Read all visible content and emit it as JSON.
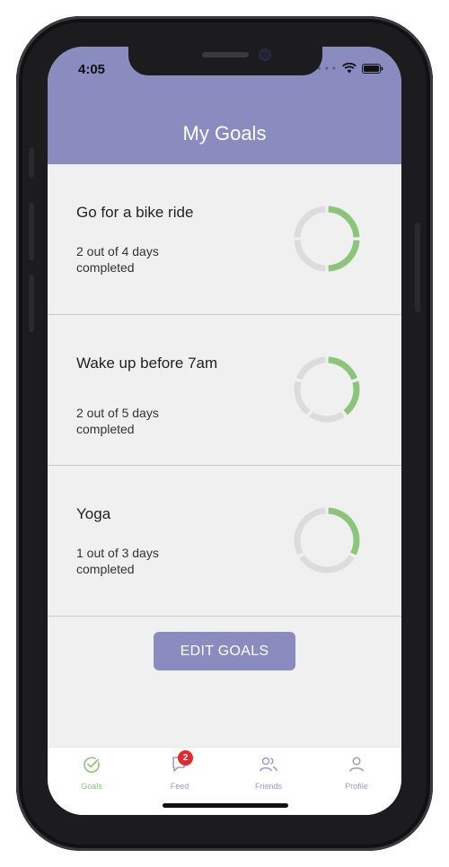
{
  "status_bar": {
    "time": "4:05"
  },
  "header": {
    "title": "My Goals"
  },
  "goals": [
    {
      "title": "Go for a bike ride",
      "progress_text": "2 out of 4 days completed",
      "completed": 2,
      "total": 4
    },
    {
      "title": "Wake up before 7am",
      "progress_text": "2 out of 5 days completed",
      "completed": 2,
      "total": 5
    },
    {
      "title": "Yoga",
      "progress_text": "1 out of 3 days completed",
      "completed": 1,
      "total": 3
    }
  ],
  "edit_button": {
    "label": "EDIT GOALS"
  },
  "tabbar": {
    "items": [
      {
        "label": "Goals",
        "icon": "check-circle-icon",
        "active": true
      },
      {
        "label": "Feed",
        "icon": "chat-bubble-icon",
        "active": false,
        "badge": "2"
      },
      {
        "label": "Friends",
        "icon": "people-icon",
        "active": false
      },
      {
        "label": "Profile",
        "icon": "person-icon",
        "active": false
      }
    ]
  },
  "colors": {
    "accent": "#8a8cc0",
    "progress_done": "#8cc57a",
    "progress_remaining": "#dcdcdc",
    "badge": "#e8262b"
  }
}
